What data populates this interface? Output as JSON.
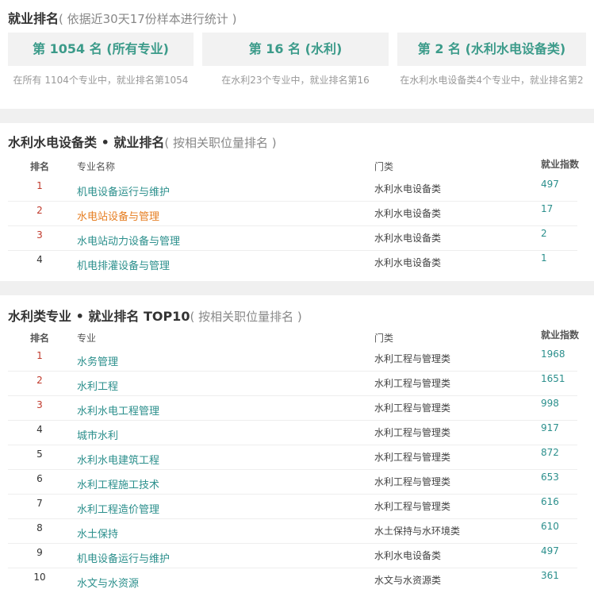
{
  "summary": {
    "title": "就业排名",
    "subtitle": "( 依据近30天17份样本进行统计 )",
    "cards": [
      {
        "label": "第 1054 名 (所有专业)",
        "note": "在所有 1104个专业中，就业排名第1054"
      },
      {
        "label": "第 16 名 (水利)",
        "note": "在水利23个专业中，就业排名第16"
      },
      {
        "label": "第 2 名 (水利水电设备类)",
        "note": "在水利水电设备类4个专业中，就业排名第2"
      }
    ]
  },
  "section1": {
    "title": "水利水电设备类 • 就业排名",
    "subtitle": "( 按相关职位量排名 )",
    "headers": {
      "rank": "排名",
      "name": "专业名称",
      "category": "门类",
      "index": "就业指数"
    },
    "rows": [
      {
        "rank": "1",
        "name": "机电设备运行与维护",
        "category": "水利水电设备类",
        "index": "497"
      },
      {
        "rank": "2",
        "name": "水电站设备与管理",
        "category": "水利水电设备类",
        "index": "17"
      },
      {
        "rank": "3",
        "name": "水电站动力设备与管理",
        "category": "水利水电设备类",
        "index": "2"
      },
      {
        "rank": "4",
        "name": "机电排灌设备与管理",
        "category": "水利水电设备类",
        "index": "1"
      }
    ]
  },
  "section2": {
    "title": "水利类专业 • 就业排名 TOP10",
    "subtitle": "( 按相关职位量排名 )",
    "headers": {
      "rank": "排名",
      "name": "专业",
      "category": "门类",
      "index": "就业指数"
    },
    "rows": [
      {
        "rank": "1",
        "name": "水务管理",
        "category": "水利工程与管理类",
        "index": "1968"
      },
      {
        "rank": "2",
        "name": "水利工程",
        "category": "水利工程与管理类",
        "index": "1651"
      },
      {
        "rank": "3",
        "name": "水利水电工程管理",
        "category": "水利工程与管理类",
        "index": "998"
      },
      {
        "rank": "4",
        "name": "城市水利",
        "category": "水利工程与管理类",
        "index": "917"
      },
      {
        "rank": "5",
        "name": "水利水电建筑工程",
        "category": "水利工程与管理类",
        "index": "872"
      },
      {
        "rank": "6",
        "name": "水利工程施工技术",
        "category": "水利工程与管理类",
        "index": "653"
      },
      {
        "rank": "7",
        "name": "水利工程造价管理",
        "category": "水利工程与管理类",
        "index": "616"
      },
      {
        "rank": "8",
        "name": "水土保持",
        "category": "水土保持与水环境类",
        "index": "610"
      },
      {
        "rank": "9",
        "name": "机电设备运行与维护",
        "category": "水利水电设备类",
        "index": "497"
      },
      {
        "rank": "10",
        "name": "水文与水资源",
        "category": "水文与水资源类",
        "index": "361"
      }
    ]
  },
  "colors": {
    "accent": "#3c9b8a",
    "link": "#2b8f8c",
    "rank_top": "#c0392b",
    "current": "#e67e22"
  }
}
